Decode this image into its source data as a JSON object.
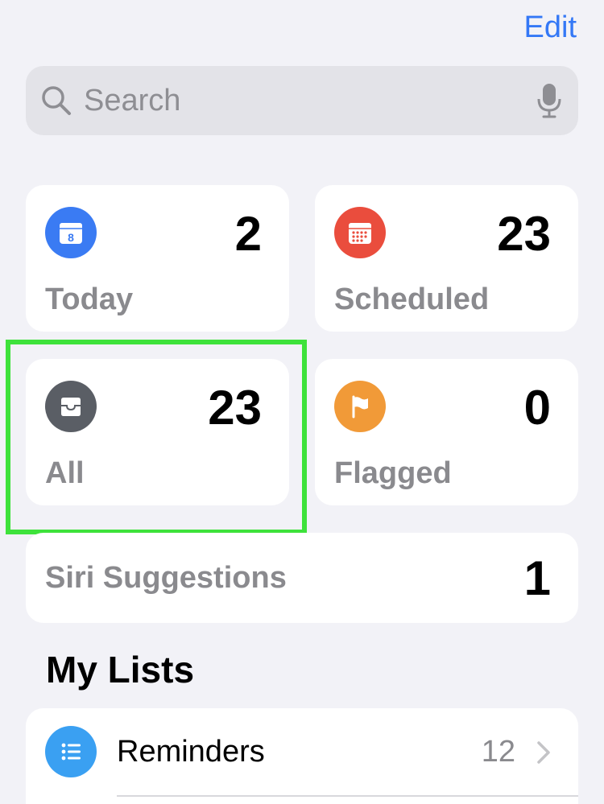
{
  "header": {
    "edit_label": "Edit"
  },
  "search": {
    "placeholder": "Search",
    "value": "",
    "icon": "magnifying-glass-icon",
    "mic_icon": "microphone-icon"
  },
  "smart_lists": [
    {
      "id": "today",
      "label": "Today",
      "count": "2",
      "icon": "calendar-today-icon",
      "icon_text": "8",
      "color": "#3a7bf3"
    },
    {
      "id": "scheduled",
      "label": "Scheduled",
      "count": "23",
      "icon": "calendar-grid-icon",
      "color": "#ea4d3d"
    },
    {
      "id": "all",
      "label": "All",
      "count": "23",
      "icon": "tray-icon",
      "color": "#5a5e65",
      "highlighted": true
    },
    {
      "id": "flagged",
      "label": "Flagged",
      "count": "0",
      "icon": "flag-icon",
      "color": "#f19a38"
    }
  ],
  "siri_suggestions": {
    "label": "Siri Suggestions",
    "count": "1"
  },
  "my_lists": {
    "title": "My Lists",
    "items": [
      {
        "name": "Reminders",
        "count": "12",
        "icon": "list-bullet-icon",
        "color": "#3aa0f2"
      }
    ]
  },
  "colors": {
    "accent": "#3478f6",
    "background": "#f2f2f7",
    "highlight": "#3ee23b"
  }
}
